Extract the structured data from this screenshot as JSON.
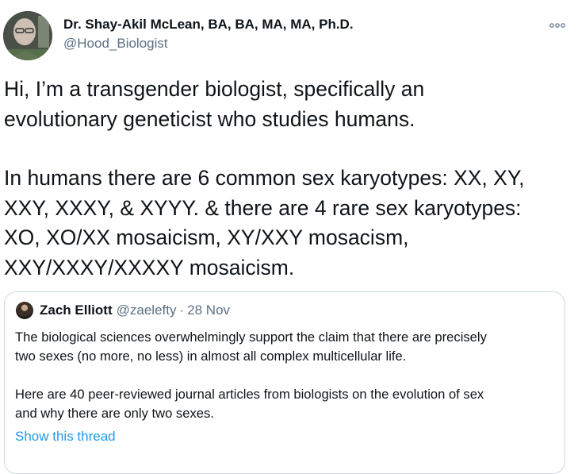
{
  "author": {
    "display_name": "Dr. Shay-Akil McLean, BA, BA, MA, MA, Ph.D.",
    "handle": "@Hood_Biologist"
  },
  "tweet": {
    "lines": [
      "Hi, I’m a transgender biologist, specifically an",
      "evolutionary geneticist who studies humans.",
      "In humans there are 6 common sex karyotypes: XX, XY,",
      "XXY, XXXY, & XYYY. & there are 4 rare sex karyotypes:",
      "XO, XO/XX mosaicism, XY/XXY mosacism,",
      "XXY/XXXY/XXXXY mosaicism."
    ]
  },
  "quoted_tweet": {
    "name": "Zach Elliott",
    "handle": "@zaelefty",
    "separator": "·",
    "date": "28 Nov",
    "lines": [
      "The biological sciences overwhelmingly support the claim that there are precisely",
      "two sexes (no more, no less) in almost all complex multicellular life.",
      "Here are 40 peer-reviewed journal articles from biologists on the evolution of sex",
      "and why there are only two sexes."
    ],
    "show_thread_label": "Show this thread"
  },
  "icons": {
    "more": "more-horizontal-icon"
  },
  "colors": {
    "text": "#0f1419",
    "secondary": "#5b7083",
    "link": "#1d9bf0",
    "border": "#cfd9de"
  }
}
